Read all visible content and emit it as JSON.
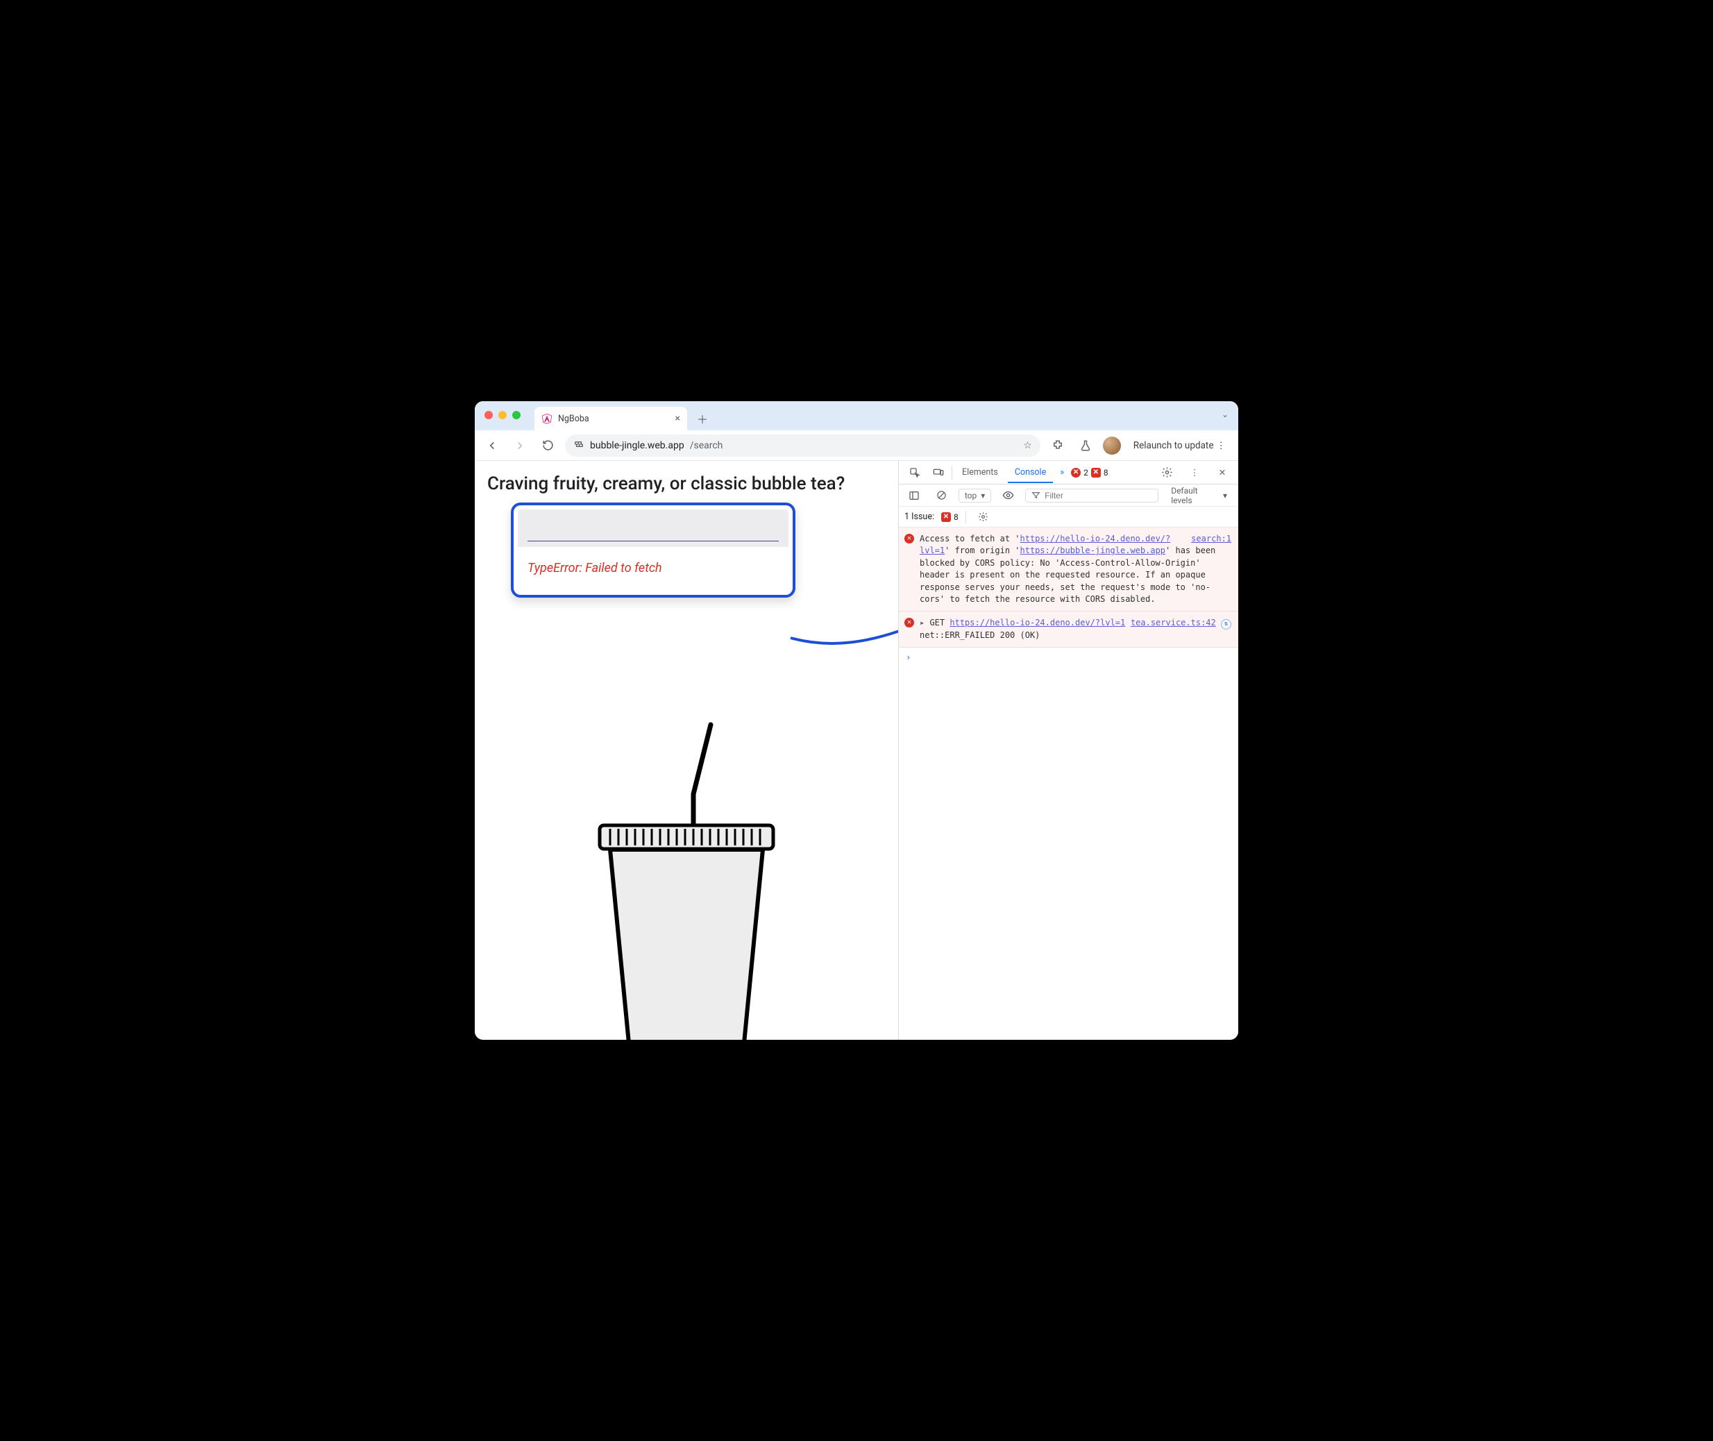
{
  "window": {
    "tab_title": "NgBoba",
    "url_host": "bubble-jingle.web.app",
    "url_path": "/search",
    "relaunch_label": "Relaunch to update"
  },
  "page": {
    "heading": "Craving fruity, creamy, or classic bubble tea?",
    "search_value": "",
    "error_text": "TypeError: Failed to fetch"
  },
  "devtools": {
    "tabs": {
      "elements": "Elements",
      "console": "Console"
    },
    "errors_badge": "2",
    "issues_badge": "8",
    "top_label": "top",
    "filter_placeholder": "Filter",
    "levels_label": "Default levels",
    "issues_line_label": "1 Issue:",
    "issues_line_count": "8",
    "messages": [
      {
        "kind": "error",
        "source_label": "search:1",
        "pre": "Access to fetch at '",
        "url1": "https://hello-io-24.deno.dev/?lvl=1",
        "mid1": "' from origin '",
        "url2": "https://bubble-jingle.web.app",
        "post": "' has been blocked by CORS policy: No 'Access-Control-Allow-Origin' header is present on the requested resource. If an opaque response serves your needs, set the request's mode to 'no-cors' to fetch the resource with CORS disabled."
      },
      {
        "kind": "error",
        "source_label": "tea.service.ts:42",
        "method": "GET",
        "url": "https://hello-io-24.deno.dev/?lvl=1",
        "tail": " net::ERR_FAILED 200 (OK)"
      }
    ]
  }
}
